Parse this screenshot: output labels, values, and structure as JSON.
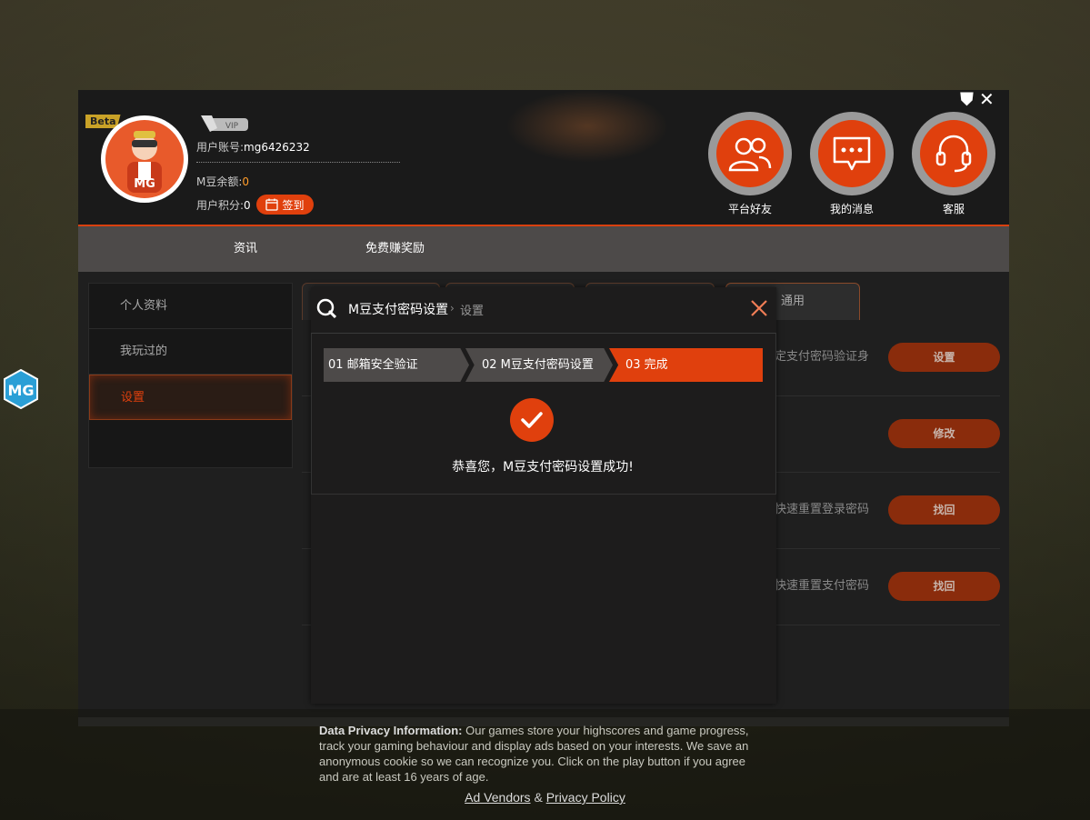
{
  "header": {
    "beta": "Beta",
    "vip": "VIP",
    "account_label": "用户账号:",
    "account_value": "mg6426232",
    "balance_label": "M豆余额:",
    "balance_value": "0",
    "points_label": "用户积分:",
    "points_value": "0",
    "signin_label": "签到",
    "avatar_text": "MG",
    "buttons": [
      {
        "label": "平台好友",
        "icon": "friends-icon"
      },
      {
        "label": "我的消息",
        "icon": "message-icon"
      },
      {
        "label": "客服",
        "icon": "headset-icon"
      }
    ]
  },
  "nav": {
    "items": [
      "资讯",
      "免费赚奖励"
    ]
  },
  "sidebar": {
    "items": [
      "个人资料",
      "我玩过的",
      "设置"
    ],
    "active": "设置"
  },
  "tabs": {
    "general": "通用"
  },
  "rows": [
    {
      "text": "定支付密码验证身",
      "button": "设置"
    },
    {
      "text": "",
      "button": "修改"
    },
    {
      "text": "快速重置登录密码",
      "button": "找回"
    },
    {
      "text": "快速重置支付密码",
      "button": "找回"
    }
  ],
  "modal": {
    "title": "M豆支付密码设置",
    "crumb_sep": "›",
    "crumb": "设置",
    "steps": [
      "01 邮箱安全验证",
      "02 M豆支付密码设置",
      "03 完成"
    ],
    "success_message": "恭喜您，M豆支付密码设置成功!"
  },
  "privacy": {
    "heading": "Data Privacy Information:",
    "body": " Our games store your highscores and game progress, track your gaming behaviour and display ads based on your interests. We save an anonymous cookie so we can recognize you. Click on the play button if you agree and are at least 16 years of age.",
    "link1": "Ad Vendors",
    "amp": "&",
    "link2": "Privacy Policy"
  },
  "colors": {
    "accent": "#e0400d",
    "nav_bg": "#4d4a49",
    "panel_bg": "#1f1f1f"
  }
}
